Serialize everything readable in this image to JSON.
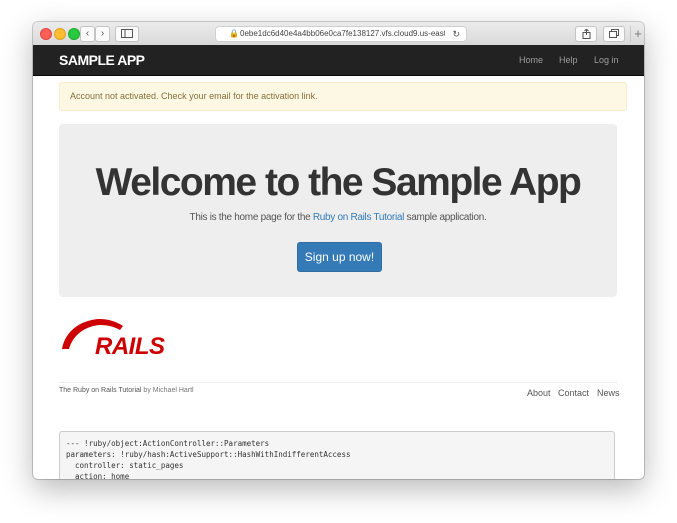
{
  "browser": {
    "url": "0ebe1dc6d40e4a4bb06e0ca7fe138127.vfs.cloud9.us-east-"
  },
  "navbar": {
    "logo": "SAMPLE APP",
    "links": [
      "Home",
      "Help",
      "Log in"
    ]
  },
  "alert": {
    "message": "Account not activated. Check your email for the activation link.",
    "color": "#fcf8e3"
  },
  "jumbotron": {
    "heading": "Welcome to the Sample App",
    "tagline_before": "This is the home page for the ",
    "tagline_link": "Ruby on Rails Tutorial",
    "tagline_after": " sample application.",
    "button": "Sign up now!",
    "button_color": "#337ab7"
  },
  "rails_logo": {
    "text": "RAILS",
    "color": "#cc0000"
  },
  "footer": {
    "link_text": "The Ruby on Rails Tutorial",
    "by_text": " by Michael Hartl",
    "links": [
      "About",
      "Contact",
      "News"
    ]
  },
  "debug": {
    "lines": [
      "--- !ruby/object:ActionController::Parameters",
      "parameters: !ruby/hash:ActiveSupport::HashWithIndifferentAccess",
      "  controller: static_pages",
      "  action: home"
    ]
  }
}
